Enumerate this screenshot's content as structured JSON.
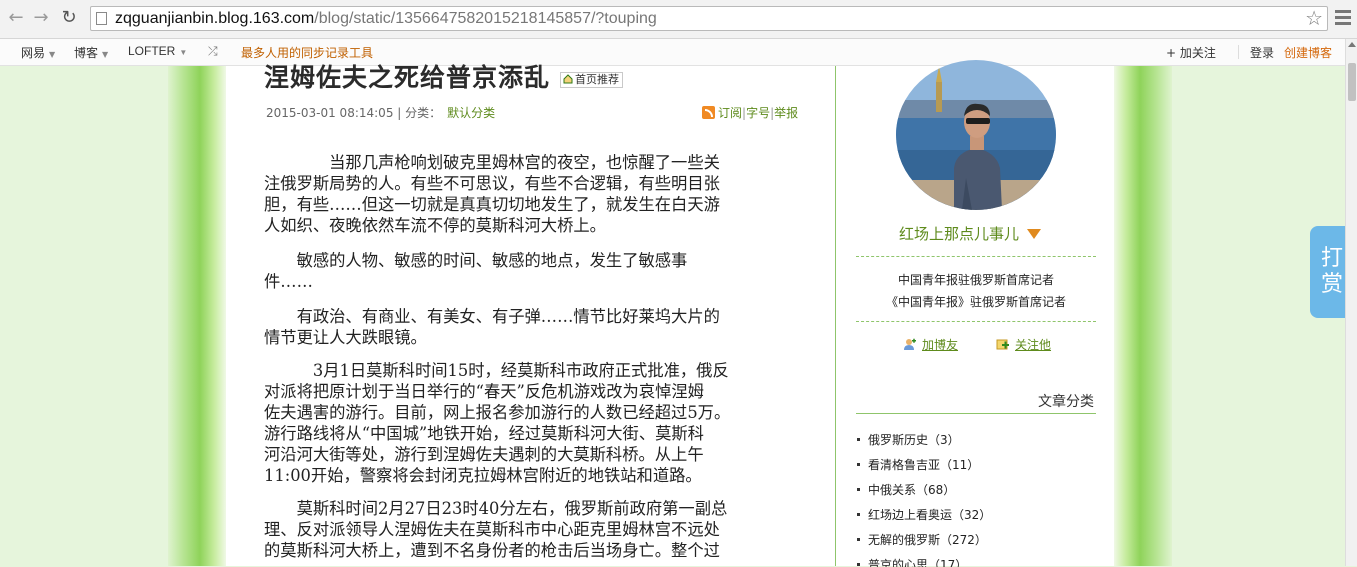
{
  "browser": {
    "url_host": "zqguanjianbin.blog.163.com",
    "url_path": "/blog/static/1356647582015218145857/?touping"
  },
  "topbar": {
    "items": [
      "网易",
      "博客",
      "LOFTER"
    ],
    "promo": "最多人用的同步记录工具",
    "follow": "+ 加关注",
    "login": "登录",
    "create_blog": "创建博客"
  },
  "article": {
    "title": "涅姆佐夫之死给普京添乱",
    "badge": "首页推荐",
    "date": "2015-03-01 08:14:05",
    "category_label": "分类：",
    "category": "默认分类",
    "actions": [
      "订阅",
      "字号",
      "举报"
    ],
    "paragraphs": [
      [
        "　　　　当那几声枪响划破克里姆林宫的夜空，也惊醒了一些关",
        "注俄罗斯局势的人。有些不可思议，有些不合逻辑，有些明目张",
        "胆，有些……但这一切就是真真切切地发生了，就发生在白天游",
        "人如织、夜晚依然车流不停的莫斯科河大桥上。"
      ],
      [
        "　　敏感的人物、敏感的时间、敏感的地点，发生了敏感事",
        "件……"
      ],
      [
        "　　有政治、有商业、有美女、有子弹……情节比好莱坞大片的",
        "情节更让人大跌眼镜。"
      ],
      [
        "　　　3月1日莫斯科时间15时，经莫斯科市政府正式批准，俄反",
        "对派将把原计划于当日举行的“春天”反危机游戏改为哀悼涅姆",
        "佐夫遇害的游行。目前，网上报名参加游行的人数已经超过5万。",
        "游行路线将从“中国城”地铁开始，经过莫斯科河大街、莫斯科",
        "河沿河大街等处，游行到涅姆佐夫遇刺的大莫斯科桥。从上午",
        "11:00开始，警察将会封闭克拉姆林宫附近的地铁站和道路。"
      ],
      [
        "　　莫斯科时间2月27日23时40分左右，俄罗斯前政府第一副总",
        "理、反对派领导人涅姆佐夫在莫斯科市中心距克里姆林宫不远处",
        "的莫斯科河大桥上，遭到不名身份者的枪击后当场身亡。整个过"
      ]
    ]
  },
  "sidebar": {
    "blog_name": "红场上那点儿事儿",
    "bio_line1": "中国青年报驻俄罗斯首席记者",
    "bio_line2": "《中国青年报》驻俄罗斯首席记者",
    "add_friend": "加博友",
    "follow_him": "关注他",
    "category_title": "文章分类",
    "categories": [
      {
        "name": "俄罗斯历史",
        "count": "（3）"
      },
      {
        "name": "看清格鲁吉亚",
        "count": "（11）"
      },
      {
        "name": "中俄关系",
        "count": "（68）"
      },
      {
        "name": "红场边上看奥运",
        "count": "（32）"
      },
      {
        "name": "无解的俄罗斯",
        "count": "（272）"
      },
      {
        "name": "普京的心思",
        "count": "（17）"
      }
    ]
  },
  "reward": {
    "label": "打赏"
  }
}
